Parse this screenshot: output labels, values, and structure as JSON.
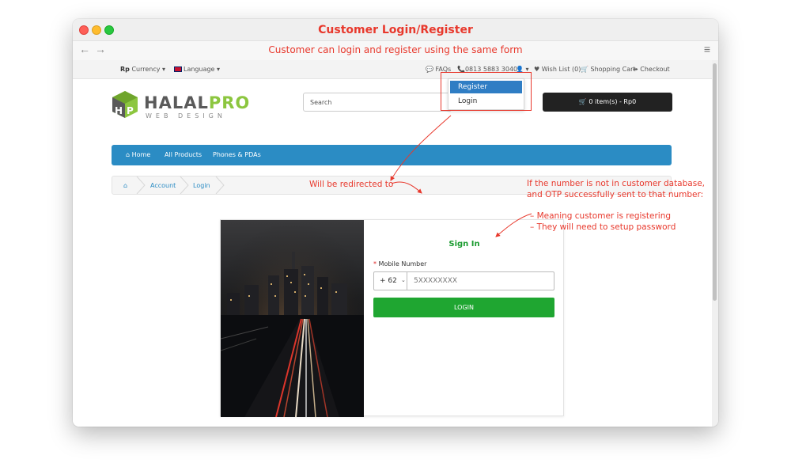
{
  "window": {
    "title": "Customer Login/Register"
  },
  "browser": {
    "subtitle": "Customer can login and register using the same form",
    "back": "←",
    "forward": "→",
    "menu": "≡"
  },
  "topbar": {
    "currency_prefix": "Rp",
    "currency": "Currency ▾",
    "language": "Language ▾",
    "faqs": "FAQs",
    "phone": "0813 5883 3040",
    "user_menu": "▾",
    "wishlist": "Wish List (0)",
    "cart_link": "Shopping Cart",
    "checkout": "Checkout"
  },
  "dropdown": {
    "items": [
      "Register",
      "Login"
    ]
  },
  "logo": {
    "name_a": "HALAL",
    "name_b": "PRO",
    "tagline": "WEB DESIGN"
  },
  "search": {
    "placeholder": "Search"
  },
  "cart": {
    "label": "0 item(s) - Rp0"
  },
  "nav": {
    "home": "Home",
    "all_products": "All Products",
    "phones": "Phones & PDAs"
  },
  "breadcrumb": {
    "items": [
      "Account",
      "Login"
    ]
  },
  "form": {
    "title": "Sign In",
    "mobile_label": "Mobile Number",
    "country_code": "+ 62",
    "phone_placeholder": "5XXXXXXXX",
    "login_button": "LOGIN"
  },
  "notes": {
    "redirect": "Will be redirected to",
    "condition_1": "If the number is not in customer database,",
    "condition_2": "and OTP successfully sent to that number:",
    "meaning_1": "– Meaning customer is registering",
    "meaning_2": "– They will need to setup password"
  },
  "colors": {
    "accent": "#e8382c",
    "nav": "#2b8cc4",
    "button": "#1fa631",
    "dropdown_active": "#2f7dc4"
  }
}
